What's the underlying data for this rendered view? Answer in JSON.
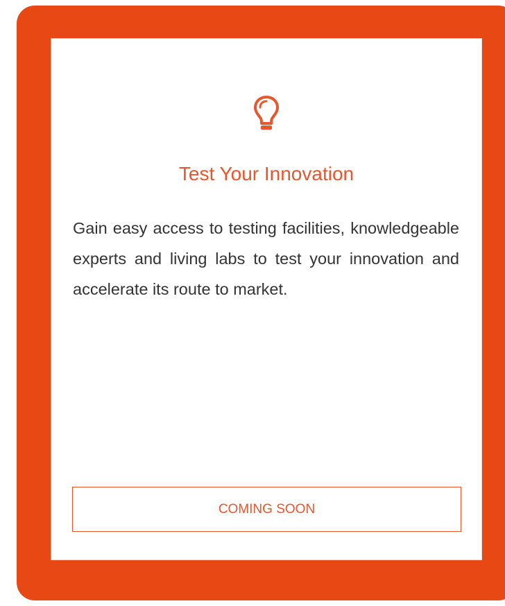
{
  "card": {
    "icon": "lightbulb-icon",
    "title": "Test Your Innovation",
    "description": "Gain easy access to testing facilities, knowledgeable experts and living labs to test your innovation and accelerate its route to market.",
    "button_label": "COMING SOON"
  },
  "colors": {
    "frame": "#e84813",
    "accent": "#e8562e",
    "text": "#333333"
  }
}
